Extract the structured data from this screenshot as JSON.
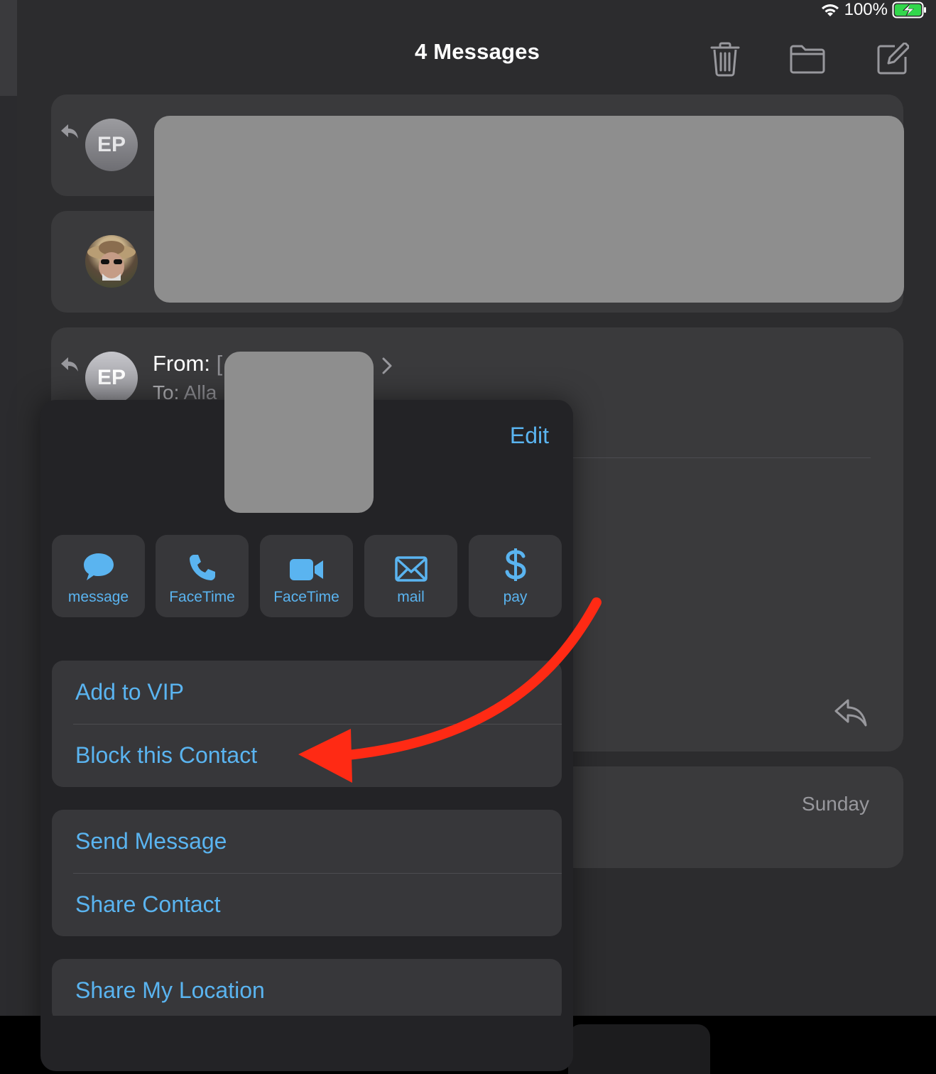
{
  "status_bar": {
    "battery": "100%"
  },
  "header": {
    "title": "4 Messages"
  },
  "messages": [
    {
      "initials": "EP"
    },
    {
      "initials": ""
    },
    {
      "initials": "EP",
      "from_label": "From:",
      "to_label": "To:",
      "to_value": "Alla",
      "from_value_partial": "["
    },
    {
      "date": "Sunday"
    }
  ],
  "contact_card": {
    "edit_label": "Edit",
    "actions": [
      {
        "label": "message",
        "icon": "message-bubble-icon"
      },
      {
        "label": "FaceTime",
        "icon": "phone-icon"
      },
      {
        "label": "FaceTime",
        "icon": "video-camera-icon"
      },
      {
        "label": "mail",
        "icon": "envelope-icon"
      },
      {
        "label": "pay",
        "icon": "dollar-icon"
      }
    ],
    "group1": [
      "Add to VIP",
      "Block this Contact"
    ],
    "group2": [
      "Send Message",
      "Share Contact"
    ],
    "group3": [
      "Share My Location"
    ]
  },
  "colors": {
    "accent": "#5ab4f0",
    "annotation_arrow": "#ff2a14"
  }
}
